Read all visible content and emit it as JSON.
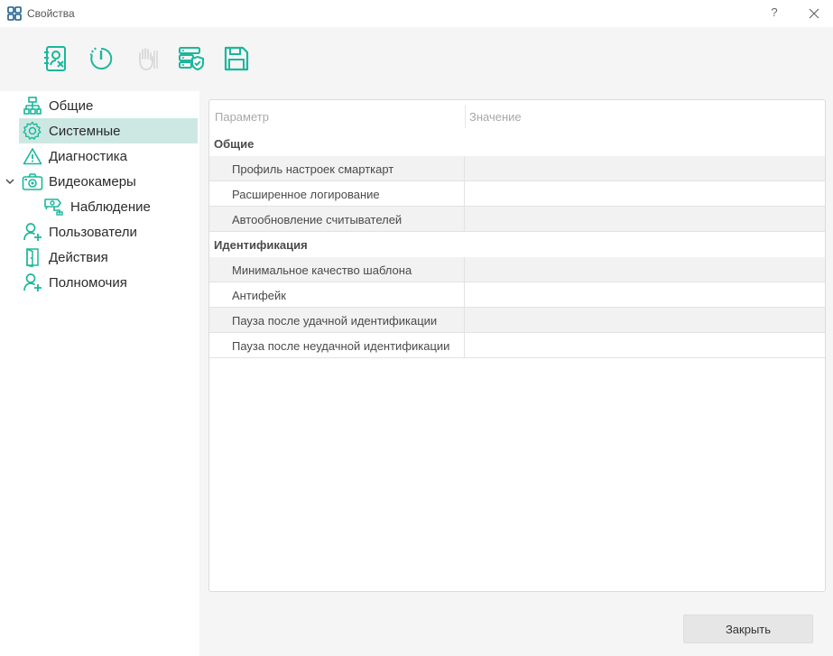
{
  "window": {
    "title": "Свойства",
    "help_label": "?",
    "accent_color": "#1bb79b"
  },
  "toolbar": {
    "buttons": [
      {
        "icon": "contact-book-remove-icon",
        "enabled": true
      },
      {
        "icon": "power-timer-icon",
        "enabled": true
      },
      {
        "icon": "hand-stop-icon",
        "enabled": false
      },
      {
        "icon": "server-shield-icon",
        "enabled": true
      },
      {
        "icon": "save-icon",
        "enabled": true
      }
    ]
  },
  "tree": {
    "items": [
      {
        "label": "Общие",
        "icon": "hierarchy-icon"
      },
      {
        "label": "Системные",
        "icon": "gear-icon",
        "selected": true
      },
      {
        "label": "Диагностика",
        "icon": "warning-icon"
      },
      {
        "label": "Видеокамеры",
        "icon": "camera-icon",
        "expanded": true
      },
      {
        "label": "Наблюдение",
        "icon": "cctv-icon",
        "child": true
      },
      {
        "label": "Пользователи",
        "icon": "user-add-icon"
      },
      {
        "label": "Действия",
        "icon": "door-icon"
      },
      {
        "label": "Полномочия",
        "icon": "user-add-icon"
      }
    ]
  },
  "grid": {
    "header": {
      "param": "Параметр",
      "value": "Значение"
    },
    "groups": [
      {
        "name": "Общие",
        "rows": [
          {
            "name": "Профиль настроек смарткарт",
            "value": ""
          },
          {
            "name": "Расширенное логирование",
            "value": ""
          },
          {
            "name": "Автообновление считывателей",
            "value": ""
          }
        ]
      },
      {
        "name": "Идентификация",
        "rows": [
          {
            "name": "Минимальное качество шаблона",
            "value": ""
          },
          {
            "name": "Антифейк",
            "value": ""
          },
          {
            "name": "Пауза после удачной идентификации",
            "value": ""
          },
          {
            "name": "Пауза после неудачной идентификации",
            "value": ""
          }
        ]
      }
    ]
  },
  "footer": {
    "close_label": "Закрыть"
  }
}
